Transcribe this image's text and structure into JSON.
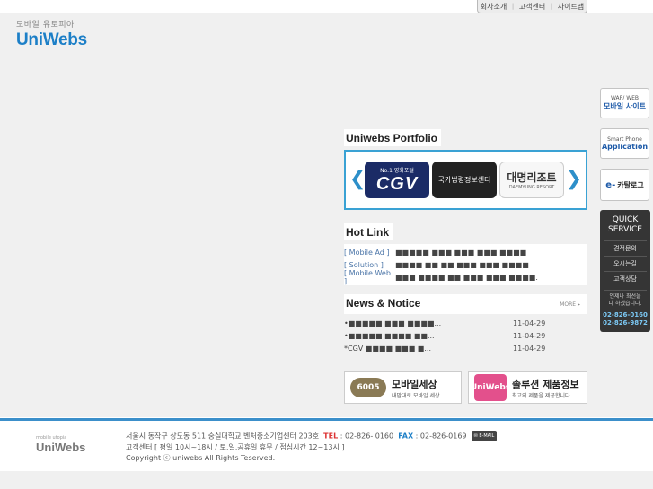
{
  "top_nav": {
    "items": [
      "회사소개",
      "고객센터",
      "사이트맵"
    ]
  },
  "logo": {
    "sub": "모바일 유토피아",
    "main_a": "Uni",
    "main_b": "Webs"
  },
  "portfolio": {
    "title": "Uniwebs Portfolio",
    "cgv_small": "No.1 영화포털",
    "cgv_big": "CGV",
    "gov": "국가법령정보센터",
    "daemyung_big": "대명리조트",
    "daemyung_small": "DAEMYUNG RESORT"
  },
  "hot_link": {
    "title": "Hot Link",
    "items": [
      {
        "cat": "[ Mobile Ad ]",
        "text": "■■■■■ ■■■ ■■■ ■■■ ■■■■"
      },
      {
        "cat": "[ Solution ]",
        "text": "■■■■ ■■ ■■ ■■■ ■■■ ■■■■"
      },
      {
        "cat": "[ Mobile Web ]",
        "text": "■■■ ■■■■ ■■ ■■■ ■■■ ■■■■."
      }
    ]
  },
  "news": {
    "title": "News & Notice",
    "more": "MORE ▸",
    "items": [
      {
        "text": "•■■■■■ ■■■ ■■■■...",
        "date": "11-04-29"
      },
      {
        "text": "•■■■■■ ■■■■ ■■...",
        "date": "11-04-29"
      },
      {
        "text": "*CGV ■■■■ ■■■ ■...",
        "date": "11-04-29"
      }
    ]
  },
  "banners": {
    "b1_icon": "6005",
    "b1_title": "모바일세상",
    "b1_sub": "내맘대로 모바일 세상",
    "b2_icon": "UniWebs",
    "b2_title": "솔루션 제품정보",
    "b2_sub": "최고의 제품을 제공합니다."
  },
  "side": {
    "btn1_small": "WAP/ WEB",
    "btn1_big": "모바일 사이트",
    "btn2_small": "Smart Phone",
    "btn2_big": "Application",
    "btn3_e": "e-",
    "btn3_big": "카탈로그",
    "quick_h1": "QUICK",
    "quick_h2": "SERVICE",
    "quick_items": [
      "견적문의",
      "오시는길",
      "고객상담"
    ],
    "quick_note1": "언제나 최선을",
    "quick_note2": "다 하겠습니다.",
    "quick_phone1": "02-826-0160",
    "quick_phone2": "02-826-9872"
  },
  "footer": {
    "logo_sub": "mobile utopia",
    "logo_main": "UniWebs",
    "address": "서울시 동작구 상도동 511 숭실대학교 벤처중소기업센터 203호",
    "tel_label": "TEL",
    "tel": ": 02-826- 0160",
    "fax_label": "FAX",
    "fax": ": 02-826-0169",
    "email": "✉ E-MAIL",
    "hours": "고객센터 [ 평일 10시~18시  /  토,일,공휴일 휴무  /  점심시간 12~13시 ]",
    "copyright": "Copyright ⓒ uniwebs All Rights Teserved."
  }
}
